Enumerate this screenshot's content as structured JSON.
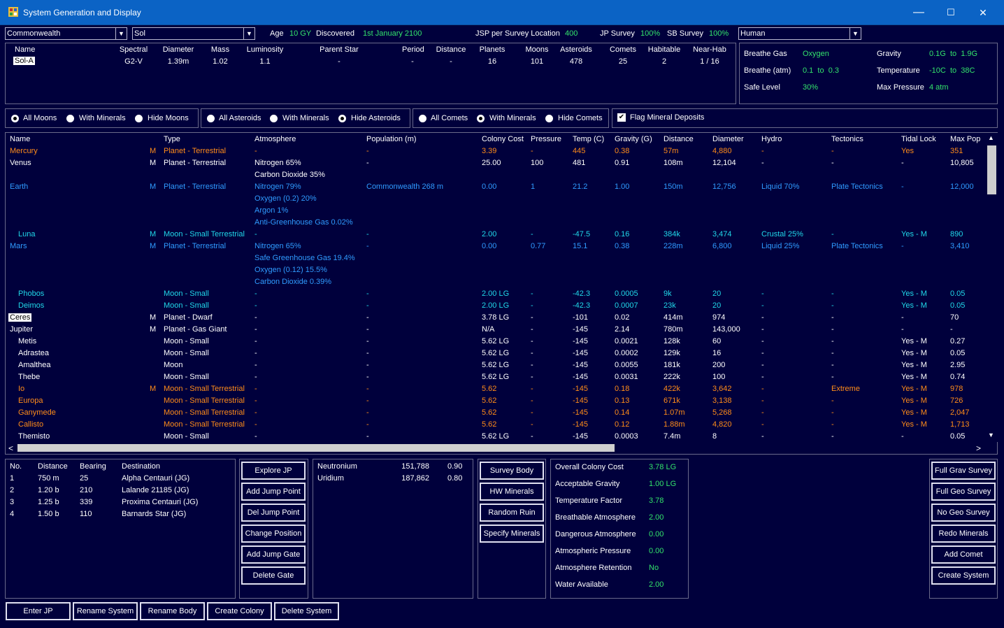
{
  "window": {
    "title": "System Generation and Display",
    "min": "—",
    "max": "☐",
    "close": "✕"
  },
  "selectors": {
    "race": "Commonwealth",
    "system": "Sol",
    "species": "Human"
  },
  "header": {
    "age_label": "Age",
    "age_value": "10 GY",
    "discovered_label": "Discovered",
    "discovered_value": "1st January 2100",
    "jsp_label": "JSP per Survey Location",
    "jsp_value": "400",
    "jp_survey_label": "JP Survey",
    "jp_survey_value": "100%",
    "sb_survey_label": "SB Survey",
    "sb_survey_value": "100%"
  },
  "star_table": {
    "headers": [
      "Name",
      "Spectral",
      "Diameter",
      "Mass",
      "Luminosity",
      "Parent Star",
      "Period",
      "Distance",
      "Planets",
      "Moons",
      "Asteroids",
      "Comets",
      "Habitable",
      "Near-Hab"
    ],
    "row": [
      "Sol-A",
      "G2-V",
      "1.39m",
      "1.02",
      "1.1",
      "-",
      "-",
      "-",
      "16",
      "101",
      "478",
      "25",
      "2",
      "1 / 16"
    ]
  },
  "species_panel": {
    "breathe_gas_label": "Breathe Gas",
    "breathe_gas_value": "Oxygen",
    "gravity_label": "Gravity",
    "gravity_value": "0.1G  to  1.9G",
    "breathe_atm_label": "Breathe (atm)",
    "breathe_atm_value": "0.1  to  0.3",
    "temperature_label": "Temperature",
    "temperature_value": "-10C  to  38C",
    "safe_level_label": "Safe Level",
    "safe_level_value": "30%",
    "max_pressure_label": "Max Pressure",
    "max_pressure_value": "4 atm"
  },
  "filters": {
    "moons": [
      "All Moons",
      "With Minerals",
      "Hide Moons"
    ],
    "asteroids": [
      "All Asteroids",
      "With Minerals",
      "Hide Asteroids"
    ],
    "comets": [
      "All Comets",
      "With Minerals",
      "Hide Comets"
    ],
    "flag_minerals": "Flag Mineral Deposits"
  },
  "body_table": {
    "headers": [
      "Name",
      "Type",
      "Atmosphere",
      "Population (m)",
      "Colony Cost",
      "Pressure",
      "Temp (C)",
      "Gravity (G)",
      "Distance",
      "Diameter",
      "Hydro",
      "Tectonics",
      "Tidal Lock",
      "Max Pop"
    ],
    "rows": [
      {
        "color": "o",
        "indent": false,
        "selected": false,
        "name": "Mercury",
        "m": "M",
        "type": "Planet - Terrestrial",
        "atm": [
          "-"
        ],
        "pop": "-",
        "cost": "3.39",
        "press": "-",
        "temp": "445",
        "grav": "0.38",
        "dist": "57m",
        "diam": "4,880",
        "hydro": "-",
        "tect": "-",
        "tidal": "Yes",
        "maxpop": "351"
      },
      {
        "color": "w",
        "indent": false,
        "selected": false,
        "name": "Venus",
        "m": "M",
        "type": "Planet - Terrestrial",
        "atm": [
          "Nitrogen 65%",
          "Carbon Dioxide 35%"
        ],
        "pop": "-",
        "cost": "25.00",
        "press": "100",
        "temp": "481",
        "grav": "0.91",
        "dist": "108m",
        "diam": "12,104",
        "hydro": "-",
        "tect": "-",
        "tidal": "-",
        "maxpop": "10,805"
      },
      {
        "color": "b",
        "indent": false,
        "selected": false,
        "name": "Earth",
        "m": "M",
        "type": "Planet - Terrestrial",
        "atm": [
          "Nitrogen 79%",
          "Oxygen (0.2) 20%",
          "Argon 1%",
          "Anti-Greenhouse Gas 0.02%"
        ],
        "pop": "Commonwealth 268 m",
        "cost": "0.00",
        "press": "1",
        "temp": "21.2",
        "grav": "1.00",
        "dist": "150m",
        "diam": "12,756",
        "hydro": "Liquid 70%",
        "tect": "Plate Tectonics",
        "tidal": "-",
        "maxpop": "12,000"
      },
      {
        "color": "c",
        "indent": true,
        "selected": false,
        "name": "Luna",
        "m": "M",
        "type": "Moon - Small Terrestrial",
        "atm": [
          "-"
        ],
        "pop": "-",
        "cost": "2.00",
        "press": "-",
        "temp": "-47.5",
        "grav": "0.16",
        "dist": "384k",
        "diam": "3,474",
        "hydro": "Crustal 25%",
        "tect": "-",
        "tidal": "Yes - M",
        "maxpop": "890"
      },
      {
        "color": "b",
        "indent": false,
        "selected": false,
        "name": "Mars",
        "m": "M",
        "type": "Planet - Terrestrial",
        "atm": [
          "Nitrogen 65%",
          "Safe Greenhouse Gas 19.4%",
          "Oxygen (0.12) 15.5%",
          "Carbon Dioxide 0.39%"
        ],
        "pop": "-",
        "cost": "0.00",
        "press": "0.77",
        "temp": "15.1",
        "grav": "0.38",
        "dist": "228m",
        "diam": "6,800",
        "hydro": "Liquid 25%",
        "tect": "Plate Tectonics",
        "tidal": "-",
        "maxpop": "3,410"
      },
      {
        "color": "c",
        "indent": true,
        "selected": false,
        "name": "Phobos",
        "m": "",
        "type": "Moon - Small",
        "atm": [
          "-"
        ],
        "pop": "-",
        "cost": "2.00 LG",
        "press": "-",
        "temp": "-42.3",
        "grav": "0.0005",
        "dist": "9k",
        "diam": "20",
        "hydro": "-",
        "tect": "-",
        "tidal": "Yes - M",
        "maxpop": "0.05"
      },
      {
        "color": "c",
        "indent": true,
        "selected": false,
        "name": "Deimos",
        "m": "",
        "type": "Moon - Small",
        "atm": [
          "-"
        ],
        "pop": "-",
        "cost": "2.00 LG",
        "press": "-",
        "temp": "-42.3",
        "grav": "0.0007",
        "dist": "23k",
        "diam": "20",
        "hydro": "-",
        "tect": "-",
        "tidal": "Yes - M",
        "maxpop": "0.05"
      },
      {
        "color": "w",
        "indent": false,
        "selected": true,
        "name": "Ceres",
        "m": "M",
        "type": "Planet - Dwarf",
        "atm": [
          "-"
        ],
        "pop": "-",
        "cost": "3.78 LG",
        "press": "-",
        "temp": "-101",
        "grav": "0.02",
        "dist": "414m",
        "diam": "974",
        "hydro": "-",
        "tect": "-",
        "tidal": "-",
        "maxpop": "70"
      },
      {
        "color": "w",
        "indent": false,
        "selected": false,
        "name": "Jupiter",
        "m": "M",
        "type": "Planet - Gas Giant",
        "atm": [
          "-"
        ],
        "pop": "-",
        "cost": "N/A",
        "press": "-",
        "temp": "-145",
        "grav": "2.14",
        "dist": "780m",
        "diam": "143,000",
        "hydro": "-",
        "tect": "-",
        "tidal": "-",
        "maxpop": "-"
      },
      {
        "color": "w",
        "indent": true,
        "selected": false,
        "name": "Metis",
        "m": "",
        "type": "Moon - Small",
        "atm": [
          "-"
        ],
        "pop": "-",
        "cost": "5.62 LG",
        "press": "-",
        "temp": "-145",
        "grav": "0.0021",
        "dist": "128k",
        "diam": "60",
        "hydro": "-",
        "tect": "-",
        "tidal": "Yes - M",
        "maxpop": "0.27"
      },
      {
        "color": "w",
        "indent": true,
        "selected": false,
        "name": "Adrastea",
        "m": "",
        "type": "Moon - Small",
        "atm": [
          "-"
        ],
        "pop": "-",
        "cost": "5.62 LG",
        "press": "-",
        "temp": "-145",
        "grav": "0.0002",
        "dist": "129k",
        "diam": "16",
        "hydro": "-",
        "tect": "-",
        "tidal": "Yes - M",
        "maxpop": "0.05"
      },
      {
        "color": "w",
        "indent": true,
        "selected": false,
        "name": "Amalthea",
        "m": "",
        "type": "Moon",
        "atm": [
          "-"
        ],
        "pop": "-",
        "cost": "5.62 LG",
        "press": "-",
        "temp": "-145",
        "grav": "0.0055",
        "dist": "181k",
        "diam": "200",
        "hydro": "-",
        "tect": "-",
        "tidal": "Yes - M",
        "maxpop": "2.95"
      },
      {
        "color": "w",
        "indent": true,
        "selected": false,
        "name": "Thebe",
        "m": "",
        "type": "Moon - Small",
        "atm": [
          "-"
        ],
        "pop": "-",
        "cost": "5.62 LG",
        "press": "-",
        "temp": "-145",
        "grav": "0.0031",
        "dist": "222k",
        "diam": "100",
        "hydro": "-",
        "tect": "-",
        "tidal": "Yes - M",
        "maxpop": "0.74"
      },
      {
        "color": "o",
        "indent": true,
        "selected": false,
        "name": "Io",
        "m": "M",
        "type": "Moon - Small Terrestrial",
        "atm": [
          "-"
        ],
        "pop": "-",
        "cost": "5.62",
        "press": "-",
        "temp": "-145",
        "grav": "0.18",
        "dist": "422k",
        "diam": "3,642",
        "hydro": "-",
        "tect": "Extreme",
        "tidal": "Yes - M",
        "maxpop": "978"
      },
      {
        "color": "o",
        "indent": true,
        "selected": false,
        "name": "Europa",
        "m": "",
        "type": "Moon - Small Terrestrial",
        "atm": [
          "-"
        ],
        "pop": "-",
        "cost": "5.62",
        "press": "-",
        "temp": "-145",
        "grav": "0.13",
        "dist": "671k",
        "diam": "3,138",
        "hydro": "-",
        "tect": "-",
        "tidal": "Yes - M",
        "maxpop": "726"
      },
      {
        "color": "o",
        "indent": true,
        "selected": false,
        "name": "Ganymede",
        "m": "",
        "type": "Moon - Small Terrestrial",
        "atm": [
          "-"
        ],
        "pop": "-",
        "cost": "5.62",
        "press": "-",
        "temp": "-145",
        "grav": "0.14",
        "dist": "1.07m",
        "diam": "5,268",
        "hydro": "-",
        "tect": "-",
        "tidal": "Yes - M",
        "maxpop": "2,047"
      },
      {
        "color": "o",
        "indent": true,
        "selected": false,
        "name": "Callisto",
        "m": "",
        "type": "Moon - Small Terrestrial",
        "atm": [
          "-"
        ],
        "pop": "-",
        "cost": "5.62",
        "press": "-",
        "temp": "-145",
        "grav": "0.12",
        "dist": "1.88m",
        "diam": "4,820",
        "hydro": "-",
        "tect": "-",
        "tidal": "Yes - M",
        "maxpop": "1,713"
      },
      {
        "color": "w",
        "indent": true,
        "selected": false,
        "name": "Themisto",
        "m": "",
        "type": "Moon - Small",
        "atm": [
          "-"
        ],
        "pop": "-",
        "cost": "5.62 LG",
        "press": "-",
        "temp": "-145",
        "grav": "0.0003",
        "dist": "7.4m",
        "diam": "8",
        "hydro": "-",
        "tect": "-",
        "tidal": "-",
        "maxpop": "0.05"
      }
    ]
  },
  "jump_points": {
    "headers": [
      "No.",
      "Distance",
      "Bearing",
      "Destination"
    ],
    "rows": [
      [
        "1",
        "750 m",
        "25",
        "Alpha Centauri (JG)"
      ],
      [
        "2",
        "1.20 b",
        "210",
        "Lalande 21185 (JG)"
      ],
      [
        "3",
        "1.25 b",
        "339",
        "Proxima Centauri (JG)"
      ],
      [
        "4",
        "1.50 b",
        "110",
        "Barnards Star (JG)"
      ]
    ]
  },
  "jp_buttons": [
    "Explore JP",
    "Add Jump Point",
    "Del Jump Point",
    "Change Position",
    "Add Jump Gate",
    "Delete Gate"
  ],
  "minerals": [
    [
      "Neutronium",
      "151,788",
      "0.90"
    ],
    [
      "Uridium",
      "187,862",
      "0.80"
    ]
  ],
  "survey_buttons": [
    "Survey Body",
    "HW Minerals",
    "Random Ruin",
    "Specify Minerals"
  ],
  "colony_cost": [
    [
      "Overall Colony Cost",
      "3.78 LG"
    ],
    [
      "Acceptable Gravity",
      "1.00 LG"
    ],
    [
      "Temperature Factor",
      "3.78"
    ],
    [
      "Breathable Atmosphere",
      "2.00"
    ],
    [
      "Dangerous Atmosphere",
      "0.00"
    ],
    [
      "Atmospheric Pressure",
      "0.00"
    ],
    [
      "Atmosphere Retention",
      "No"
    ],
    [
      "Water Available",
      "2.00"
    ]
  ],
  "right_buttons": [
    "Full Grav Survey",
    "Full Geo Survey",
    "No Geo Survey",
    "Redo Minerals",
    "Add Comet",
    "Create System"
  ],
  "bottom_buttons": [
    "Enter JP",
    "Rename System",
    "Rename Body",
    "Create Colony",
    "Delete System"
  ],
  "colors": {
    "green": "#33e36b",
    "orange": "#ff8c19",
    "blue": "#2f9bff",
    "cyan": "#20d8e8",
    "background": "#00003c",
    "titlebar": "#0b63c5"
  },
  "scrollbars": {
    "vertical_arrow_up": "▲",
    "vertical_arrow_down": "▼",
    "horizontal_arrow_left": "<",
    "horizontal_arrow_right": ">"
  }
}
